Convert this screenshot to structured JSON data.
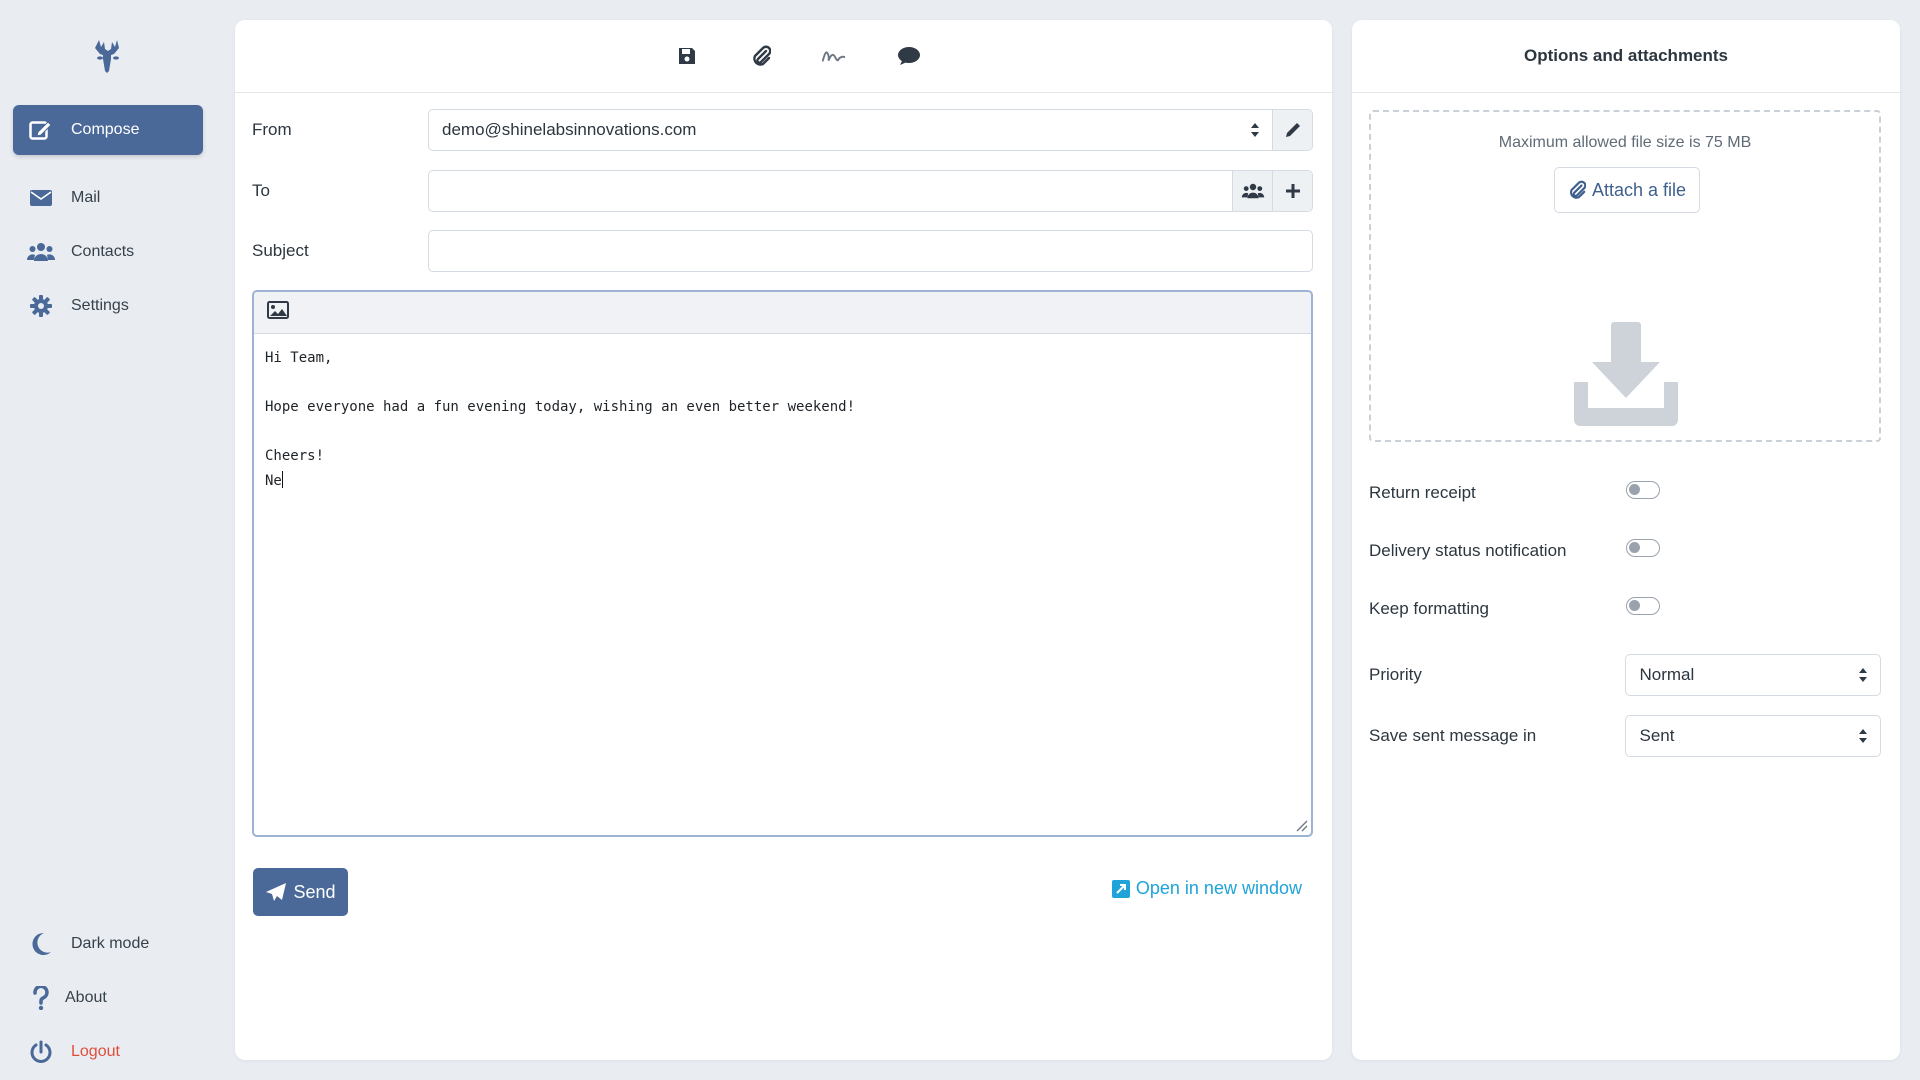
{
  "sidebar": {
    "items": [
      {
        "label": "Compose",
        "icon": "compose-icon"
      },
      {
        "label": "Mail",
        "icon": "envelope-icon"
      },
      {
        "label": "Contacts",
        "icon": "users-icon"
      },
      {
        "label": "Settings",
        "icon": "gear-icon"
      }
    ],
    "bottom": [
      {
        "label": "Dark mode",
        "icon": "moon-icon"
      },
      {
        "label": "About",
        "icon": "question-icon"
      },
      {
        "label": "Logout",
        "icon": "power-icon"
      }
    ]
  },
  "compose": {
    "toolbar": [
      "save-icon",
      "paperclip-icon",
      "signature-icon",
      "comment-icon"
    ],
    "from_label": "From",
    "from_value": "demo@shinelabsinnovations.com",
    "to_label": "To",
    "to_value": "",
    "subject_label": "Subject",
    "subject_value": "",
    "body": "Hi Team,\n\nHope everyone had a fun evening today, wishing an even better weekend!\n\nCheers!\nNe",
    "send_label": "Send",
    "open_new_label": "Open in new window"
  },
  "options": {
    "title": "Options and attachments",
    "max_size_text": "Maximum allowed file size is 75 MB",
    "attach_label": "Attach a file",
    "return_receipt_label": "Return receipt",
    "delivery_status_label": "Delivery status notification",
    "keep_formatting_label": "Keep formatting",
    "priority_label": "Priority",
    "priority_value": "Normal",
    "save_sent_label": "Save sent message in",
    "save_sent_value": "Sent",
    "toggles": {
      "return_receipt": false,
      "delivery_status": false,
      "keep_formatting": false
    }
  },
  "colors": {
    "accent": "#4a6998",
    "link": "#1fa3d9",
    "logout": "#e04e3b"
  }
}
